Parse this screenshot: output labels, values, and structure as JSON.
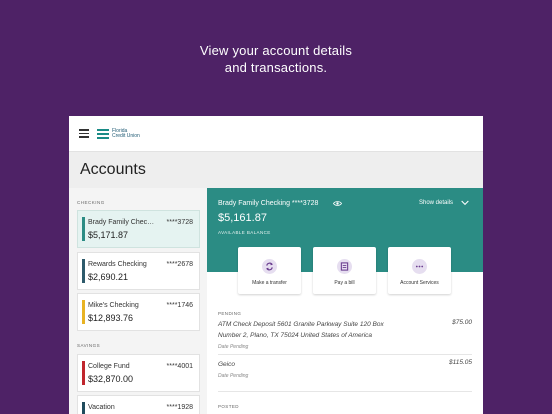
{
  "promo": {
    "line1": "View your account details",
    "line2": "and transactions."
  },
  "brand": {
    "logo_line1": "Florida",
    "logo_line2": "Credit Union"
  },
  "page_title": "Accounts",
  "sidebar": {
    "checking_label": "CHECKING",
    "savings_label": "SAVINGS",
    "accounts": [
      {
        "name": "Brady Family Chec…",
        "number": "****3728",
        "balance": "$5,171.87",
        "color": "#2b8c84"
      },
      {
        "name": "Rewards Checking",
        "number": "****2678",
        "balance": "$2,690.21",
        "color": "#2d5a6b"
      },
      {
        "name": "Mike's Checking",
        "number": "****1746",
        "balance": "$12,893.76",
        "color": "#e8b323"
      },
      {
        "name": "College Fund",
        "number": "****4001",
        "balance": "$32,870.00",
        "color": "#c0262d"
      },
      {
        "name": "Vacation",
        "number": "****1928",
        "balance": "",
        "color": "#1f4b5c"
      }
    ]
  },
  "detail": {
    "title": "Brady Family Checking ****3728",
    "show_details": "Show details",
    "balance": "$5,161.87",
    "available_label": "AVAILABLE BALANCE",
    "actions": [
      {
        "label": "Make a transfer",
        "icon": "transfer-icon"
      },
      {
        "label": "Pay a bill",
        "icon": "bill-icon"
      },
      {
        "label": "Account Services",
        "icon": "more-icon"
      }
    ]
  },
  "transactions": {
    "pending_label": "PENDING",
    "posted_label": "POSTED",
    "pending": [
      {
        "description": "ATM Check Deposit 5601 Granite Parkway Suite 120 Box Number 2, Plano, TX 75024 United States of America",
        "amount": "$75.00",
        "date": "Date Pending"
      },
      {
        "description": "Geico",
        "amount": "$115.05",
        "date": "Date Pending"
      }
    ]
  },
  "colors": {
    "background": "#4e2266",
    "teal": "#2b8c84",
    "accent": "#7b4fa0"
  }
}
